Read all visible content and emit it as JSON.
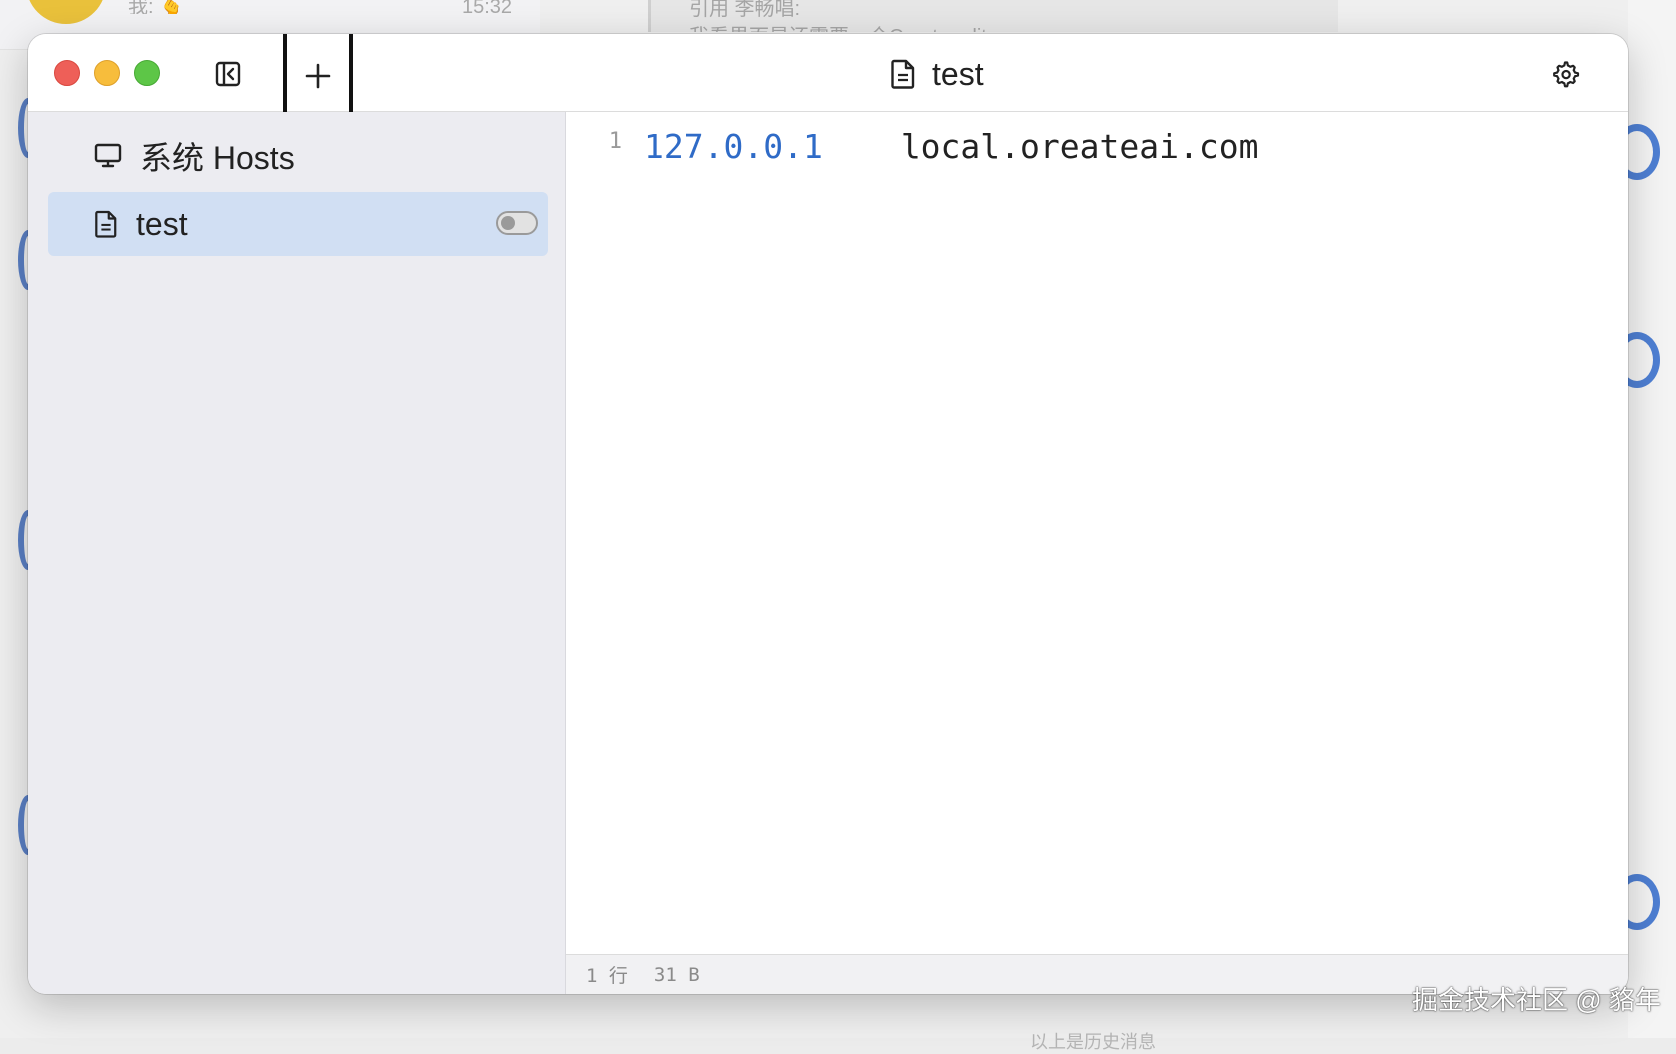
{
  "background": {
    "chat_line": "我: 🫰",
    "chat_time": "15:32",
    "quote_line1": "引用 李畅唱:",
    "quote_line2": "我看界面是还需要一个Create editor",
    "bottom_text": "以上是历史消息"
  },
  "watermark": "掘金技术社区 @ 貉年",
  "window": {
    "title": "test",
    "icons": {
      "sidebar_toggle": "sidebar-toggle-icon",
      "add": "plus-icon",
      "title_doc": "document-icon",
      "settings": "gear-icon"
    }
  },
  "sidebar": {
    "items": [
      {
        "label": "系统 Hosts",
        "icon": "monitor-icon",
        "selected": false
      },
      {
        "label": "test",
        "icon": "document-icon",
        "selected": true,
        "enabled": false
      }
    ]
  },
  "editor": {
    "lines": [
      {
        "number": "1",
        "ip": "127.0.0.1",
        "domain": "local.oreateai.com"
      }
    ]
  },
  "status": {
    "lines": "1 行",
    "size": "31 B"
  },
  "colors": {
    "accent": "#2f6bc7",
    "selected_bg": "#d1dff3",
    "sidebar_bg": "#ececf1"
  }
}
